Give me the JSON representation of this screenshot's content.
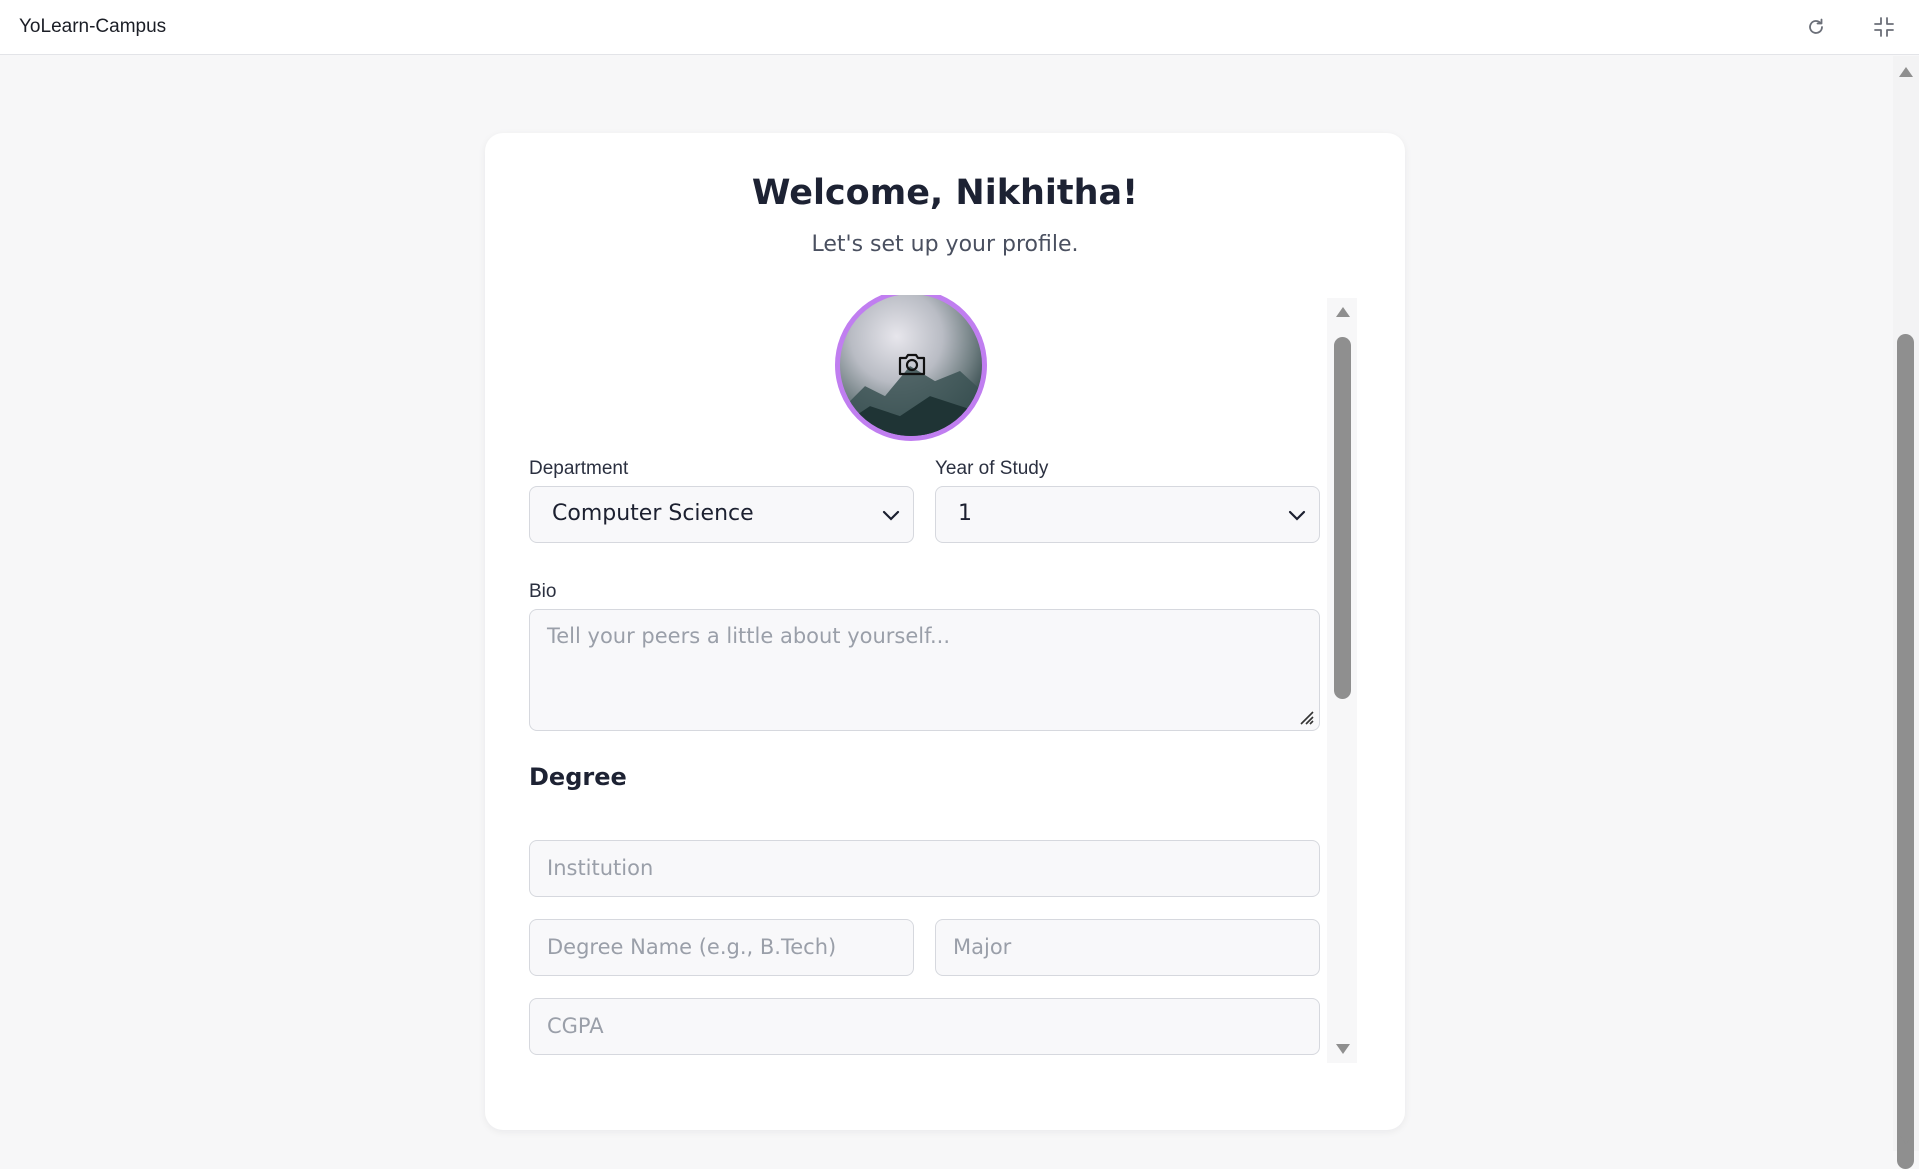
{
  "app": {
    "title": "YoLearn-Campus"
  },
  "toolbar": {
    "refresh_icon": "refresh-icon",
    "collapse_icon": "collapse-icon"
  },
  "card": {
    "welcome": "Welcome, Nikhitha!",
    "subtitle": "Let's set up your profile."
  },
  "profile": {
    "avatar_icon": "camera-icon"
  },
  "form": {
    "department": {
      "label": "Department",
      "value": "Computer Science"
    },
    "year": {
      "label": "Year of Study",
      "value": "1"
    },
    "bio": {
      "label": "Bio",
      "placeholder": "Tell your peers a little about yourself..."
    },
    "degree": {
      "title": "Degree",
      "institution_placeholder": "Institution",
      "degree_name_placeholder": "Degree Name (e.g., B.Tech)",
      "major_placeholder": "Major",
      "cgpa_placeholder": "CGPA"
    }
  },
  "colors": {
    "accent_ring": "#c07ef0",
    "background": "#f7f7f8",
    "card": "#ffffff"
  }
}
